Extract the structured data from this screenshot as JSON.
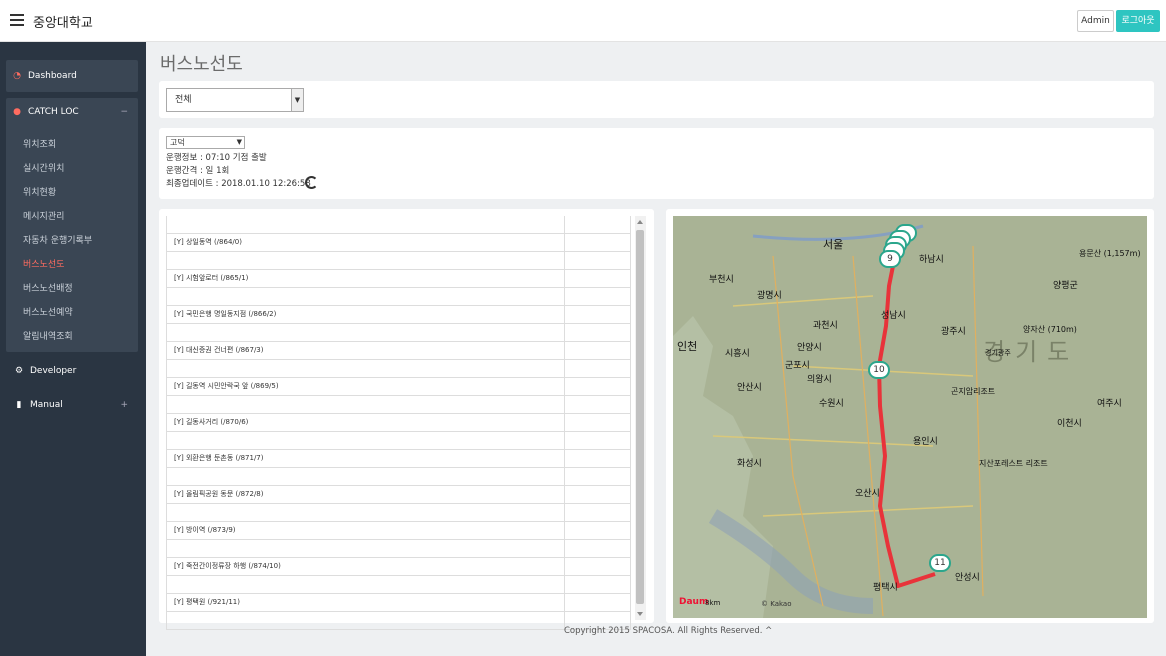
{
  "header": {
    "brand": "중앙대학교",
    "admin_label": "Admin",
    "logout_label": "로그아웃"
  },
  "sidebar": {
    "dashboard": "Dashboard",
    "catchloc": "CATCH LOC",
    "catchloc_toggle": "−",
    "sub_items": [
      "위치조회",
      "실시간위치",
      "위치현황",
      "메시지관리",
      "자동차 운행기록부",
      "버스노선도",
      "버스노선배정",
      "버스노선예약",
      "알림내역조회"
    ],
    "active_index": 5,
    "developer": "Developer",
    "manual": "Manual",
    "manual_toggle": "+"
  },
  "page": {
    "title": "버스노선도"
  },
  "filter": {
    "selected": "전체"
  },
  "route_info": {
    "route_select": "고덕",
    "schedule": "운행정보 : 07:10 기점 출발",
    "interval": "운행간격 : 일 1회",
    "updated": "최종업데이트 : 2018.01.10 12:26:58"
  },
  "stops": [
    "[Y] 상일동역 (/864/0)",
    "[Y] 시험앞로터 (/865/1)",
    "[Y] 국민은행 명일동지점 (/866/2)",
    "[Y] 대신증권 건너편 (/867/3)",
    "[Y] 길동역 시민안락국 앞 (/869/5)",
    "[Y] 길동사거리 (/870/6)",
    "[Y] 외환은행 둔촌동 (/871/7)",
    "[Y] 올림픽공원 동문 (/872/8)",
    "[Y] 방이역 (/873/9)",
    "[Y] 죽전간이정류장 하행 (/874/10)",
    "[Y] 평택원 (/921/11)"
  ],
  "map": {
    "labels": [
      "서울",
      "하남시",
      "부천시",
      "광명시",
      "과천시",
      "성남시",
      "광주시",
      "인천",
      "시흥시",
      "안양시",
      "군포시",
      "의왕시",
      "수원시",
      "용인시",
      "이천시",
      "안산시",
      "화성시",
      "오산시",
      "평택시",
      "안성시",
      "양평군",
      "여주시",
      "곤지암리조트",
      "지산포레스트 리조트",
      "경기광주",
      "양자산 (710m)",
      "용문산 (1,157m)"
    ],
    "region_label": "경기도",
    "markers": [
      "9",
      "10",
      "11"
    ],
    "scale": "8km",
    "logo": "Daum",
    "copyright": "© Kakao"
  },
  "footer": "Copyright 2015 SPACOSA. All Rights Reserved. ^"
}
